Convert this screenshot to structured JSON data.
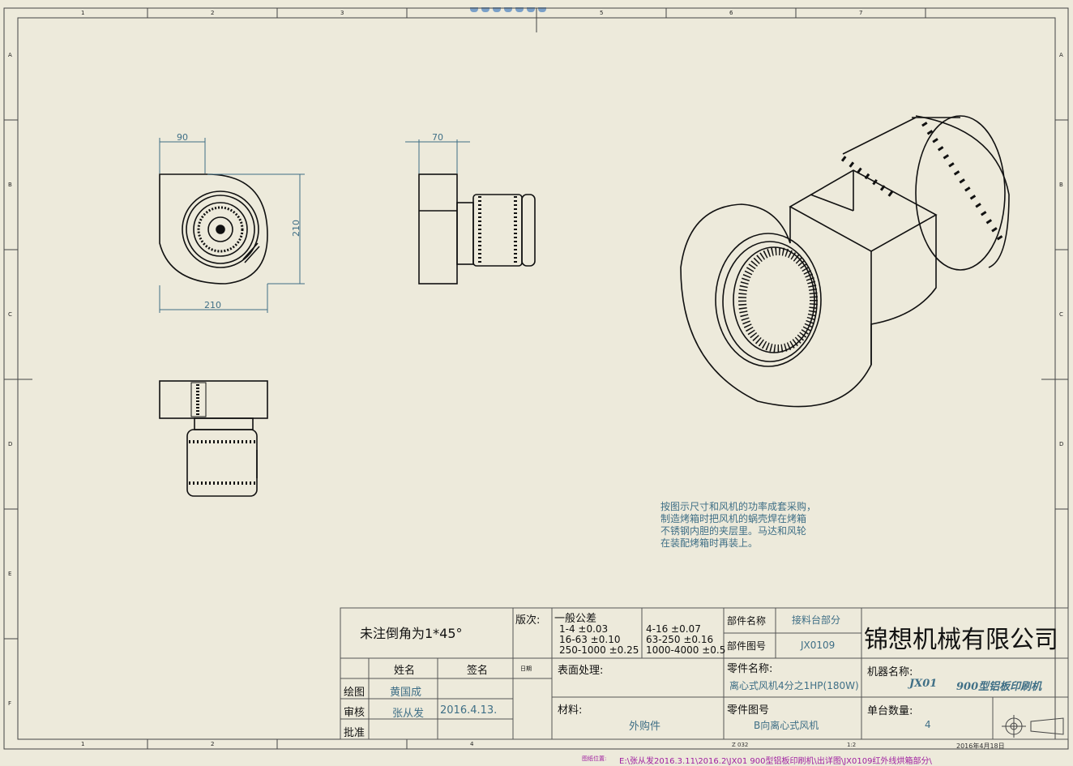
{
  "sheet": {
    "zones_top": [
      "1",
      "2",
      "3",
      "4",
      "5",
      "6",
      "7"
    ],
    "zones_side": [
      "A",
      "B",
      "C",
      "D",
      "E",
      "F"
    ]
  },
  "dimensions": {
    "front_inlet_width": "90",
    "front_width": "210",
    "front_height": "210",
    "side_width": "70"
  },
  "note": {
    "lines": [
      "按图示尺寸和风机的功率成套采购，",
      "制造烤箱时把风机的蜗壳焊在烤箱",
      "不锈钢内胆的夹层里。马达和风轮",
      "在装配烤箱时再装上。"
    ]
  },
  "title_block": {
    "chamfer_note": "未注倒角为1*45°",
    "revision_label": "版次:",
    "date_label": "日期",
    "tolerance_label": "一般公差",
    "tolerances": [
      "1-4  ±0.03",
      "16-63  ±0.10",
      "250-1000  ±0.25",
      "4-16  ±0.07",
      "63-250  ±0.16",
      "1000-4000  ±0.5"
    ],
    "component_name_label": "部件名称",
    "component_name": "接料台部分",
    "component_drawing_label": "部件图号",
    "component_drawing_no": "JX0109",
    "company": "锦想机械有限公司",
    "header_name": "姓名",
    "header_signature": "签名",
    "drawn_label": "绘图",
    "drawn_by": "黄国成",
    "checked_label": "审核",
    "checked_by": "张从发",
    "checked_date": "2016.4.13.",
    "approved_label": "批准",
    "surface_label": "表面处理:",
    "material_label": "材料:",
    "material": "外购件",
    "part_name_label": "零件名称:",
    "part_name": "离心式风机4分之1HP(180W)",
    "part_drawing_label": "零件图号",
    "part_drawing_no": "B向离心式风机",
    "machine_name_label": "机器名称:",
    "machine_code": "JX01",
    "machine_name": "900型铝板印刷机",
    "unit_qty_label": "单台数量:",
    "unit_qty": "4"
  },
  "footer": {
    "sheet_info": "Z 032",
    "scale_info": "1:2",
    "drawing_date": "2016年4月18日",
    "path_label": "图纸位置:",
    "path": "E:\\张从发2016.3.11\\2016.2\\JX01  900型铝板印刷机\\出详图\\JX0109红外线烘箱部分\\"
  }
}
